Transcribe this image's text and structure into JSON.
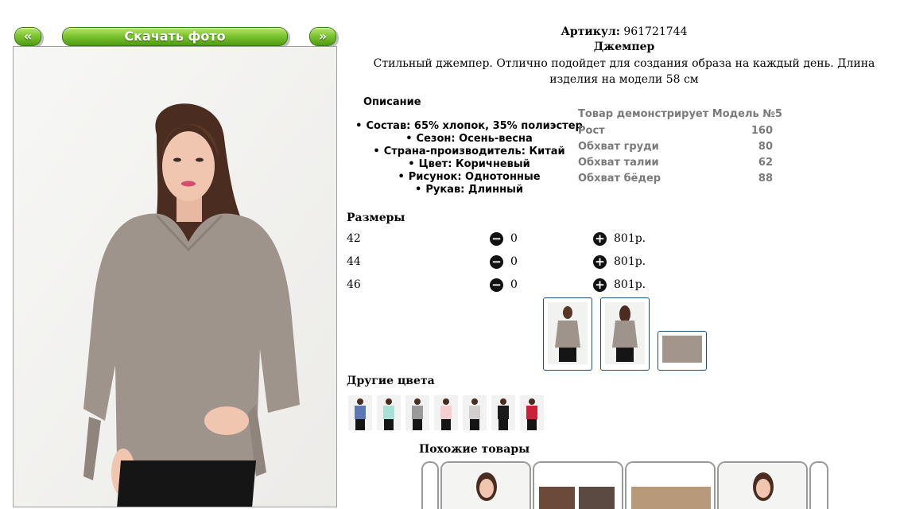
{
  "nav": {
    "prev_label": "«",
    "download_label": "Скачать фото",
    "next_label": "»"
  },
  "product": {
    "article_label": "Артикул:",
    "article_value": "961721744",
    "name": "Джемпер",
    "description": "Стильный джемпер. Отлично подойдет для создания образа на каждый день. Длина изделия на модели 58 см"
  },
  "details": {
    "heading": "Описание",
    "items": [
      "Состав: 65% хлопок, 35% полиэстер",
      "Сезон: Осень-весна",
      "Страна-производитель: Китай",
      "Цвет: Коричневый",
      "Рисунок: Однотонные",
      "Рукав: Длинный"
    ]
  },
  "model": {
    "heading": "Товар демонстрирует Модель №5",
    "rows": [
      {
        "label": "Рост",
        "value": "160"
      },
      {
        "label": "Обхват груди",
        "value": "80"
      },
      {
        "label": "Обхват талии",
        "value": "62"
      },
      {
        "label": "Обхват бёдер",
        "value": "88"
      }
    ]
  },
  "sizes": {
    "heading": "Размеры",
    "rows": [
      {
        "size": "42",
        "qty": "0",
        "price": "801р."
      },
      {
        "size": "44",
        "qty": "0",
        "price": "801р."
      },
      {
        "size": "46",
        "qty": "0",
        "price": "801р."
      }
    ]
  },
  "other_colors": {
    "heading": "Другие цвета"
  },
  "similar": {
    "heading": "Похожие товары"
  },
  "colors": {
    "accent_green": "#7dc532",
    "thumb_border": "#1f4e79",
    "sweater": "#9e948b"
  }
}
